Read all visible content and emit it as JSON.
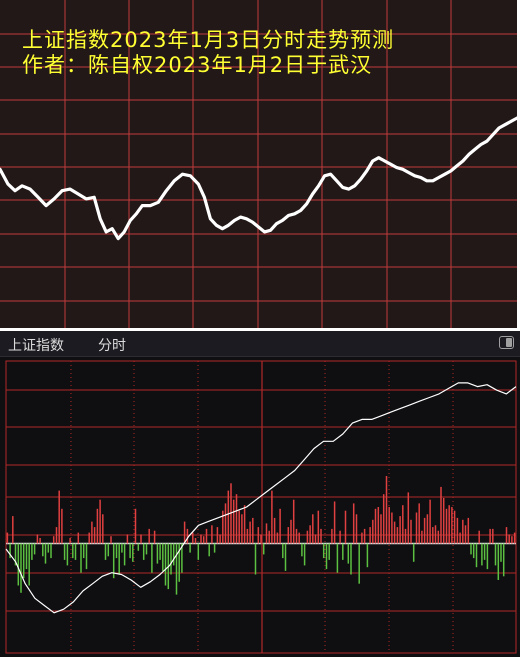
{
  "forecast_panel": {
    "title_line1": "上证指数2023年1月3日分时走势预测",
    "title_line2": "作者：陈自权2023年1月2日于武汉",
    "colors": {
      "background": "#231818",
      "grid": "#c03a3a",
      "line": "#ffffff",
      "title": "#ffff33"
    }
  },
  "intraday_panel": {
    "index_name": "上证指数",
    "view_label": "分时",
    "toggle_icon": "panel-toggle-icon",
    "colors": {
      "background": "#0f0f12",
      "grid": "#b02828",
      "price_line": "#ffffff",
      "up_bar": "#e04040",
      "down_bar": "#5cc040"
    }
  },
  "chart_data": [
    {
      "type": "line",
      "title": "上证指数2023年1月3日分时走势预测",
      "x": [
        0,
        8,
        15,
        22,
        30,
        38,
        46,
        54,
        62,
        70,
        78,
        86,
        94,
        100,
        106,
        112,
        118,
        124,
        130,
        136,
        142,
        150,
        158,
        166,
        174,
        182,
        190,
        198,
        204,
        210,
        216,
        222,
        228,
        234,
        240,
        246,
        252,
        258,
        264,
        270,
        276,
        282,
        288,
        294,
        300,
        306,
        312,
        318,
        324,
        330,
        336,
        342,
        348,
        354,
        360,
        366,
        372,
        378,
        384,
        390,
        396,
        402,
        408,
        414,
        420,
        426,
        432,
        438,
        444,
        450,
        456,
        462,
        468,
        474,
        480,
        486,
        492,
        498,
        504,
        510,
        516
      ],
      "values": [
        55,
        46,
        42,
        45,
        43,
        38,
        33,
        37,
        42,
        43,
        40,
        37,
        38,
        25,
        17,
        19,
        13,
        17,
        24,
        28,
        33,
        33,
        35,
        42,
        48,
        52,
        51,
        46,
        38,
        25,
        21,
        19,
        21,
        24,
        26,
        25,
        23,
        20,
        17,
        18,
        22,
        24,
        27,
        28,
        30,
        34,
        40,
        45,
        51,
        52,
        48,
        44,
        43,
        45,
        49,
        54,
        60,
        62,
        60,
        58,
        56,
        55,
        53,
        51,
        50,
        48,
        48,
        50,
        52,
        54,
        57,
        60,
        64,
        67,
        70,
        72,
        76,
        80,
        82,
        84,
        86
      ],
      "ylim": [
        0,
        100
      ]
    },
    {
      "type": "line",
      "title": "上证指数 分时",
      "series": [
        {
          "values": [
            -0.3,
            -1.0,
            -2.2,
            -3.0,
            -3.4,
            -3.8,
            -3.6,
            -3.2,
            -2.6,
            -2.2,
            -1.8,
            -1.6,
            -1.7,
            -2.0,
            -2.4,
            -2.1,
            -1.7,
            -1.2,
            -0.4,
            0.4,
            1.0,
            1.2,
            1.4,
            1.6,
            1.8,
            2.0,
            2.4,
            2.8,
            3.2,
            3.6,
            4.0,
            4.6,
            5.2,
            5.6,
            5.6,
            6.0,
            6.6,
            6.8,
            6.8,
            7.0,
            7.2,
            7.4,
            7.6,
            7.8,
            8.0,
            8.2,
            8.5,
            8.8,
            8.8,
            8.6,
            8.7,
            8.4,
            8.2,
            8.6
          ]
        }
      ],
      "bars": [
        0.6,
        -0.8,
        1.5,
        -1.2,
        -2.3,
        -2.7,
        -1.9,
        -1.4,
        -2.3,
        -0.9,
        -0.6,
        0.5,
        0.3,
        -0.7,
        -1.1,
        -0.5,
        -0.8,
        0.4,
        0.9,
        2.9,
        1.9,
        -0.9,
        -1.2,
        0.3,
        -0.8,
        -0.9,
        0.6,
        -1.6,
        -0.8,
        -1.4,
        0.6,
        1.2,
        0.9,
        1.9,
        2.4,
        1.6,
        -0.9,
        -0.7,
        0.4,
        -1.9,
        -0.8,
        -1.7,
        -0.5,
        -1.2,
        0.5,
        -0.8,
        -1.0,
        1.9,
        -0.4,
        0.5,
        -0.9,
        -0.6,
        0.8,
        -1.6,
        0.7,
        -1.1,
        -0.9,
        -1.5,
        -2.3,
        -2.5,
        -1.7,
        -1.2,
        -2.8,
        -2.1,
        -1.6,
        1.2,
        0.8,
        -0.5,
        0.6,
        0.3,
        -0.9,
        0.5,
        0.4,
        0.8,
        -0.7,
        1.0,
        -0.5,
        0.9,
        0.5,
        1.8,
        2.2,
        2.9,
        3.3,
        2.4,
        2.7,
        1.8,
        1.6,
        2.1,
        0.8,
        1.2,
        1.4,
        -1.7,
        0.9,
        0.5,
        -0.6,
        1.1,
        0.7,
        2.9,
        1.4,
        0.6,
        1.9,
        -0.8,
        -1.5,
        0.9,
        1.3,
        2.4,
        0.8,
        0.6,
        -0.7,
        -1.2,
        0.7,
        1.0,
        1.6,
        0.5,
        1.8,
        0.8,
        -0.8,
        -1.4,
        -0.9,
        0.8,
        2.3,
        -1.6,
        0.7,
        -0.9,
        1.8,
        -1.1,
        -1.7,
        2.2,
        1.6,
        -2.2,
        0.6,
        0.8,
        -1.3,
        0.9,
        1.3,
        1.9,
        2.0,
        1.6,
        2.7,
        3.7,
        2.0,
        1.7,
        1.2,
        0.9,
        1.5,
        2.1,
        0.8,
        2.8,
        1.3,
        -1.0,
        1.7,
        2.2,
        0.7,
        1.4,
        1.6,
        2.4,
        0.9,
        1.0,
        0.7,
        3.1,
        2.5,
        1.9,
        2.1,
        2.0,
        1.8,
        1.4,
        0.6,
        1.3,
        1.0,
        1.4,
        -0.6,
        -0.8,
        -1.3,
        0.7,
        -1.2,
        -0.9,
        -1.4,
        0.8,
        0.8,
        -1.2,
        -2.0,
        -1.0,
        -1.8,
        0.9,
        0.5,
        0.4,
        0.6
      ],
      "ylim": [
        -6,
        10
      ]
    }
  ]
}
